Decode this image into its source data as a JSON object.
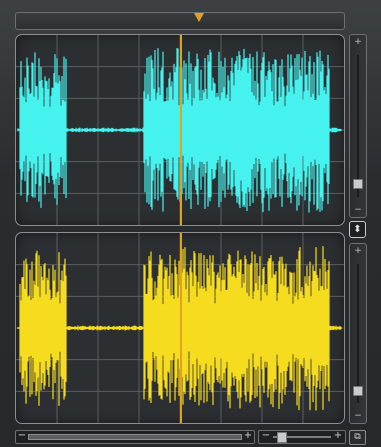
{
  "colors": {
    "top_waveform": "#46f2ee",
    "bottom_waveform": "#f6dc1e",
    "playhead": "#e3a21a",
    "grid": "#5a5e60"
  },
  "icons": {
    "playhead_marker": "triangle-down-icon",
    "link_button": "up-down-arrows-icon",
    "overview_button": "overlap-squares-icon"
  },
  "labels": {
    "plus": "+",
    "minus": "−",
    "link_glyph": "⬍",
    "overview_glyph": "⧉"
  },
  "waveform_top": {
    "segments": [
      {
        "from": 0.01,
        "to": 0.155,
        "amp": 0.9
      },
      {
        "from": 0.155,
        "to": 0.39,
        "amp": 0.03
      },
      {
        "from": 0.39,
        "to": 0.955,
        "amp": 0.95
      },
      {
        "from": 0.955,
        "to": 0.99,
        "amp": 0.03
      }
    ]
  },
  "waveform_bottom": {
    "segments": [
      {
        "from": 0.01,
        "to": 0.155,
        "amp": 0.9
      },
      {
        "from": 0.155,
        "to": 0.39,
        "amp": 0.03
      },
      {
        "from": 0.39,
        "to": 0.955,
        "amp": 0.95
      },
      {
        "from": 0.955,
        "to": 0.99,
        "amp": 0.03
      }
    ]
  },
  "playhead_fraction": 0.503,
  "zoom_level_fraction": 0.1
}
